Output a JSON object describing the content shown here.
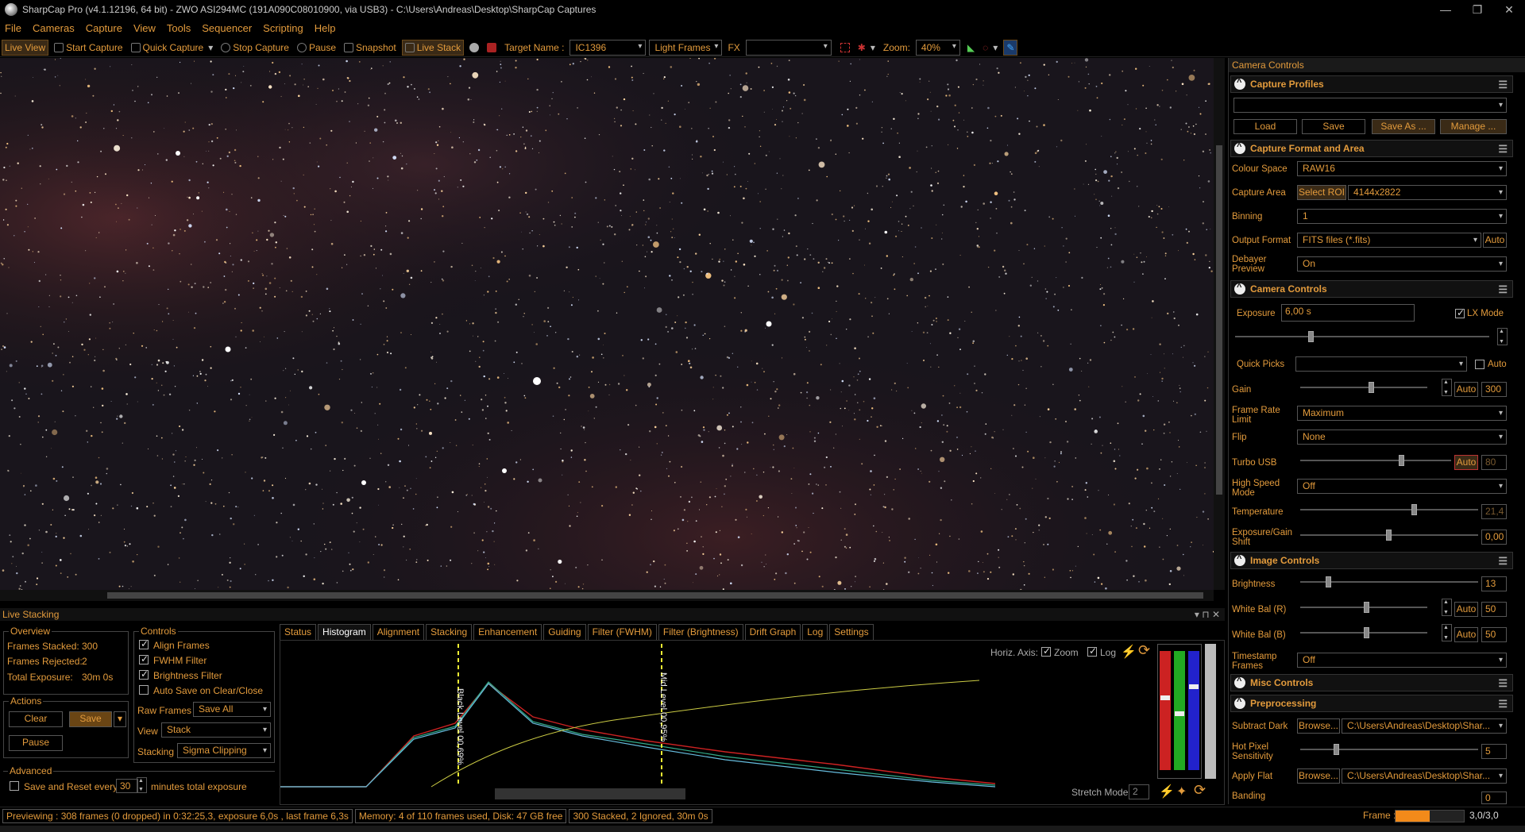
{
  "window": {
    "title": "SharpCap Pro (v4.1.12196, 64 bit) - ZWO ASI294MC (191A090C08010900, via USB3) - C:\\Users\\Andreas\\Desktop\\SharpCap Captures",
    "min": "—",
    "max": "❐",
    "close": "✕"
  },
  "menu": [
    "File",
    "Cameras",
    "Capture",
    "View",
    "Tools",
    "Sequencer",
    "Scripting",
    "Help"
  ],
  "toolbar": {
    "live_view": "Live View",
    "start_capture": "Start Capture",
    "quick_capture": "Quick Capture",
    "stop_capture": "Stop Capture",
    "pause": "Pause",
    "snapshot": "Snapshot",
    "live_stack": "Live Stack",
    "target_label": "Target Name :",
    "target_value": "IC1396",
    "frame_type": "Light Frames",
    "fx_label": "FX",
    "fx_value": "",
    "zoom_label": "Zoom:",
    "zoom_value": "40%"
  },
  "right_panel": {
    "header": "Camera Controls",
    "capture_profiles": {
      "title": "Capture Profiles",
      "profile_value": "",
      "load": "Load",
      "save": "Save",
      "save_as": "Save As ...",
      "manage": "Manage ..."
    },
    "format_area": {
      "title": "Capture Format and Area",
      "colour_space_label": "Colour Space",
      "colour_space": "RAW16",
      "capture_area_label": "Capture Area",
      "select_roi": "Select ROI",
      "capture_area": "4144x2822",
      "binning_label": "Binning",
      "binning": "1",
      "output_format_label": "Output Format",
      "output_format": "FITS files (*.fits)",
      "output_auto": "Auto",
      "debayer_label_1": "Debayer",
      "debayer_label_2": "Preview",
      "debayer": "On"
    },
    "camera_controls": {
      "title": "Camera Controls",
      "exposure_label": "Exposure",
      "exposure": "6,00 s",
      "lx_mode": "LX Mode",
      "quick_picks_label": "Quick Picks",
      "quick_picks": "",
      "quick_auto": "Auto",
      "gain_label": "Gain",
      "gain_auto": "Auto",
      "gain": "300",
      "frame_rate_label_1": "Frame Rate",
      "frame_rate_label_2": "Limit",
      "frame_rate": "Maximum",
      "flip_label": "Flip",
      "flip": "None",
      "turbo_label": "Turbo USB",
      "turbo_auto": "Auto",
      "turbo": "80",
      "high_speed_label_1": "High Speed",
      "high_speed_label_2": "Mode",
      "high_speed": "Off",
      "temperature_label": "Temperature",
      "temperature": "21,4",
      "exp_gain_label_1": "Exposure/Gain",
      "exp_gain_label_2": "Shift",
      "exp_gain": "0,00"
    },
    "image_controls": {
      "title": "Image Controls",
      "brightness_label": "Brightness",
      "brightness": "13",
      "wb_r_label": "White Bal (R)",
      "wb_r_auto": "Auto",
      "wb_r": "50",
      "wb_b_label": "White Bal (B)",
      "wb_b_auto": "Auto",
      "wb_b": "50",
      "timestamp_label_1": "Timestamp",
      "timestamp_label_2": "Frames",
      "timestamp": "Off"
    },
    "misc_title": "Misc Controls",
    "preprocessing": {
      "title": "Preprocessing",
      "subtract_dark_label": "Subtract Dark",
      "browse1": "Browse...",
      "dark_path": "C:\\Users\\Andreas\\Desktop\\Shar...",
      "hot_pixel_label_1": "Hot Pixel",
      "hot_pixel_label_2": "Sensitivity",
      "hot_pixel": "5",
      "apply_flat_label": "Apply Flat",
      "browse2": "Browse...",
      "flat_path": "C:\\Users\\Andreas\\Desktop\\Shar...",
      "banding_label": "Banding",
      "banding": "0"
    }
  },
  "live_stacking": {
    "header": "Live Stacking",
    "overview": {
      "title": "Overview",
      "frames_stacked_label": "Frames Stacked:",
      "frames_stacked": "300",
      "frames_rejected_label": "Frames Rejected:",
      "frames_rejected": "2",
      "total_exposure_label": "Total Exposure:",
      "total_exposure": "30m 0s"
    },
    "actions": {
      "title": "Actions",
      "clear": "Clear",
      "save": "Save",
      "pause": "Pause"
    },
    "controls": {
      "title": "Controls",
      "align": "Align Frames",
      "fwhm": "FWHM Filter",
      "brightness": "Brightness Filter",
      "auto_save": "Auto Save on Clear/Close",
      "raw_frames_label": "Raw Frames",
      "raw_frames": "Save All",
      "view_label": "View",
      "view": "Stack",
      "stacking_label": "Stacking",
      "stacking": "Sigma Clipping"
    },
    "advanced": {
      "title": "Advanced",
      "save_reset": "Save and Reset every",
      "minutes": "30",
      "minutes_suffix": "minutes total exposure"
    },
    "tabs": [
      "Status",
      "Histogram",
      "Alignment",
      "Stacking",
      "Enhancement",
      "Guiding",
      "Filter (FWHM)",
      "Filter (Brightness)",
      "Drift Graph",
      "Log",
      "Settings"
    ],
    "histogram": {
      "horiz_axis": "Horiz. Axis:",
      "zoom": "Zoom",
      "log": "Log",
      "black_level": "Black Level 00,69%",
      "mid_level": "Mid Level 00,95%",
      "stretch_mode": "Stretch Mode",
      "stretch_value": "2"
    }
  },
  "status": {
    "previewing": "Previewing : 308 frames (0 dropped) in 0:32:25,3, exposure 6,0s , last frame 6,3s",
    "memory": "Memory: 4 of 110 frames used, Disk: 47 GB free",
    "stacked": "300 Stacked, 2 Ignored, 30m 0s",
    "frame_label": "Frame :",
    "frame_value": "3,0/3,0"
  },
  "colors": {
    "accent": "#e39b3c",
    "background": "#000000",
    "frame_progress": "#f28a1a"
  },
  "frame_progress": 0.5
}
